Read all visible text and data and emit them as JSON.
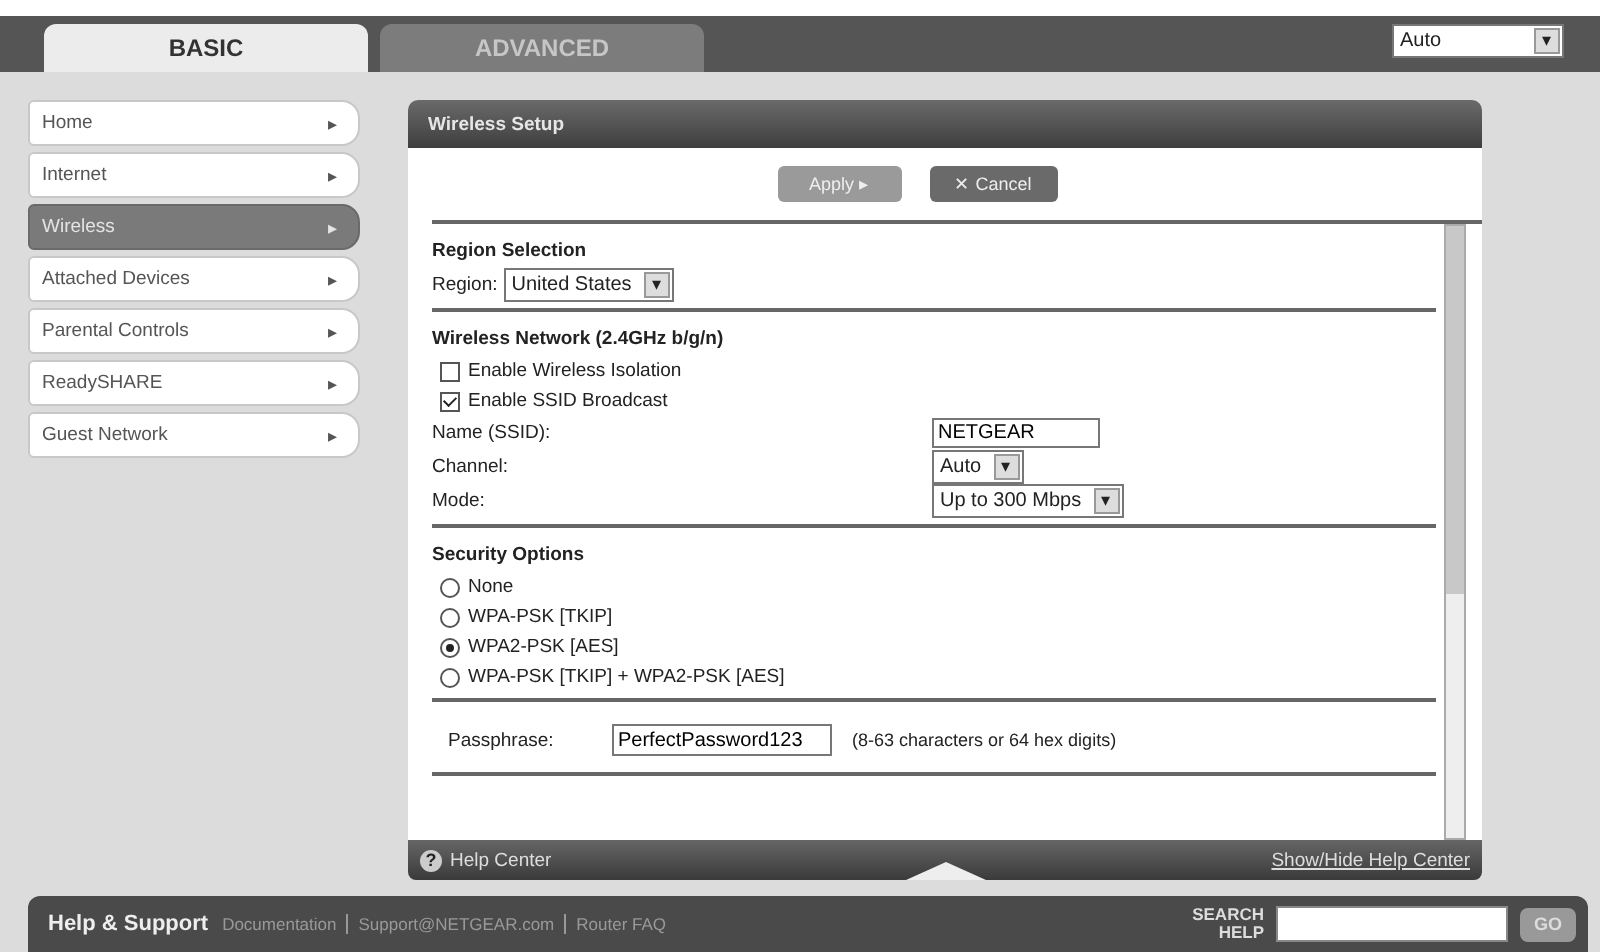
{
  "top_tabs": [
    {
      "label": "BASIC",
      "selected": true
    },
    {
      "label": "ADVANCED",
      "selected": false
    }
  ],
  "language_select": {
    "value": "Auto",
    "arrow": "▾"
  },
  "sidebar": {
    "items": [
      {
        "label": "Home",
        "selected": false,
        "arrow": "▸"
      },
      {
        "label": "Internet",
        "selected": false,
        "arrow": "▸"
      },
      {
        "label": "Wireless",
        "selected": true,
        "arrow": "▸"
      },
      {
        "label": "Attached Devices",
        "selected": false,
        "arrow": "▸"
      },
      {
        "label": "Parental Controls",
        "selected": false,
        "arrow": "▸"
      },
      {
        "label": "ReadySHARE",
        "selected": false,
        "arrow": "▸"
      },
      {
        "label": "Guest Network",
        "selected": false,
        "arrow": "▸"
      }
    ]
  },
  "panel": {
    "title": "Wireless Setup",
    "buttons": [
      {
        "kind": "apply",
        "label": "Apply ▸"
      },
      {
        "kind": "cancel",
        "label": "✕ Cancel"
      }
    ],
    "sections": [
      {
        "title": "Region Selection",
        "rows": [
          {
            "kind": "select",
            "label": "Region:",
            "value": "United States"
          }
        ]
      },
      {
        "title": "Wireless Network (2.4GHz b/g/n)",
        "rows": [
          {
            "kind": "checkbox",
            "label": "Enable Wireless Isolation",
            "checked": false
          },
          {
            "kind": "checkbox",
            "label": "Enable SSID Broadcast",
            "checked": true
          },
          {
            "kind": "text",
            "label": "Name (SSID):",
            "value": "NETGEAR"
          },
          {
            "kind": "select",
            "label": "Channel:",
            "value": "Auto"
          },
          {
            "kind": "select",
            "label": "Mode:",
            "value": "Up to 300 Mbps"
          }
        ]
      },
      {
        "title": "Security Options",
        "rows": [
          {
            "kind": "radio",
            "label": "None",
            "selected": false
          },
          {
            "kind": "radio",
            "label": "WPA-PSK [TKIP]",
            "selected": false
          },
          {
            "kind": "radio",
            "label": "WPA2-PSK [AES]",
            "selected": true
          },
          {
            "kind": "radio",
            "label": "WPA-PSK [TKIP] + WPA2-PSK [AES]",
            "selected": false
          }
        ]
      },
      {
        "rows": [
          {
            "kind": "passphrase",
            "label": "Passphrase:",
            "value": "PerfectPassword123",
            "hint": "(8-63 characters or 64 hex digits)"
          }
        ]
      }
    ],
    "help_bar": {
      "icon": "?",
      "label": "Help Center",
      "toggle": "Show/Hide Help Center"
    }
  },
  "footer": {
    "title": "Help & Support",
    "links": [
      "Documentation",
      "Support@NETGEAR.com",
      "Router FAQ"
    ],
    "search_label": "SEARCH HELP",
    "go": "GO"
  }
}
